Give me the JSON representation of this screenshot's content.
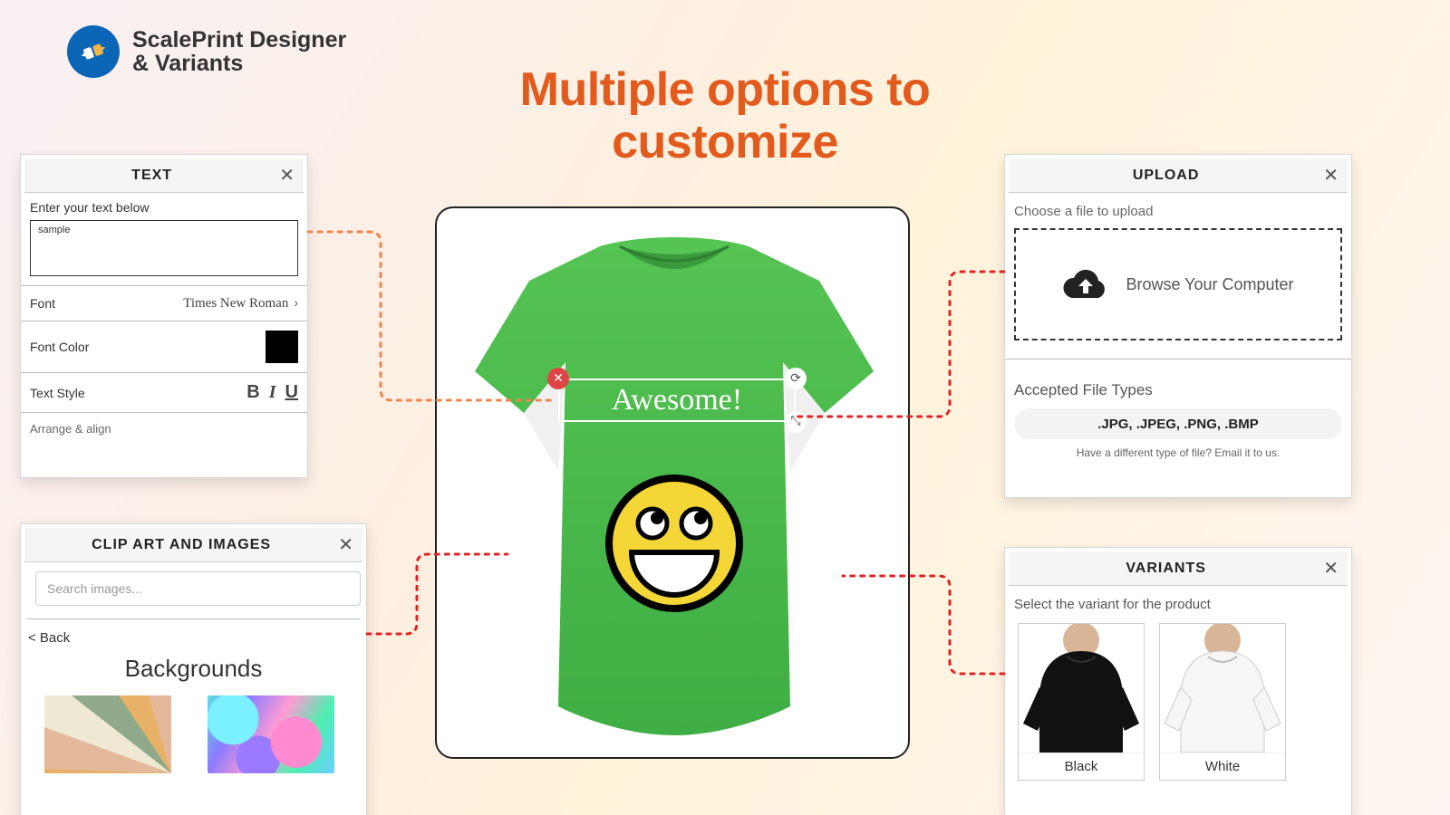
{
  "brand": {
    "line1": "ScalePrint Designer",
    "line2": "& Variants"
  },
  "headline": "Multiple options to customize",
  "textPanel": {
    "title": "TEXT",
    "hint": "Enter your text below",
    "sample": "sample",
    "fontLabel": "Font",
    "fontValue": "Times New Roman",
    "colorLabel": "Font Color",
    "colorValue": "#000000",
    "styleLabel": "Text Style",
    "arrange": "Arrange & align"
  },
  "clipPanel": {
    "title": "CLIP ART AND IMAGES",
    "searchPlaceholder": "Search images...",
    "back": "< Back",
    "section": "Backgrounds"
  },
  "uploadPanel": {
    "title": "UPLOAD",
    "hint": "Choose a file to upload",
    "browse": "Browse Your Computer",
    "acceptedTitle": "Accepted File Types",
    "accepted": ".JPG, .JPEG, .PNG, .BMP",
    "other": "Have a different type of file? Email it to us."
  },
  "variantsPanel": {
    "title": "VARIANTS",
    "hint": "Select the variant for the product",
    "items": [
      {
        "label": "Black",
        "color": "#111111"
      },
      {
        "label": "White",
        "color": "#ffffff"
      }
    ]
  },
  "canvas": {
    "text": "Awesome!"
  },
  "colors": {
    "accent": "#e25a1c",
    "connector1": "#f2864a",
    "connector2": "#e02424"
  }
}
